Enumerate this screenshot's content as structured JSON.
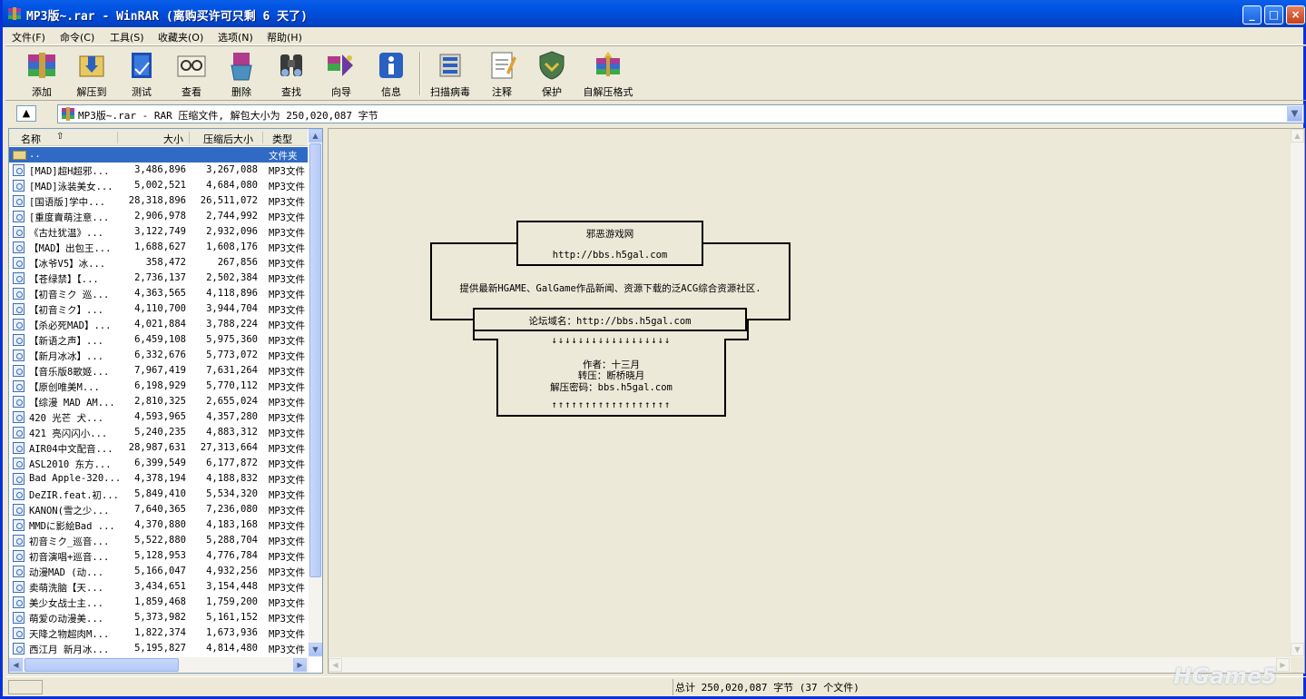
{
  "titlebar": {
    "title": "MP3版~.rar - WinRAR (离购买许可只剩 6 天了)",
    "min": "_",
    "max": "□",
    "close": "×"
  },
  "menu": [
    "文件(F)",
    "命令(C)",
    "工具(S)",
    "收藏夹(O)",
    "选项(N)",
    "帮助(H)"
  ],
  "toolbar": [
    {
      "label": "添加",
      "icon": "add-icon"
    },
    {
      "label": "解压到",
      "icon": "extract-icon"
    },
    {
      "label": "测试",
      "icon": "test-icon"
    },
    {
      "label": "查看",
      "icon": "view-icon"
    },
    {
      "label": "删除",
      "icon": "delete-icon"
    },
    {
      "label": "查找",
      "icon": "find-icon"
    },
    {
      "label": "向导",
      "icon": "wizard-icon"
    },
    {
      "label": "信息",
      "icon": "info-icon"
    },
    {
      "label": "扫描病毒",
      "icon": "virus-scan-icon"
    },
    {
      "label": "注释",
      "icon": "comment-icon"
    },
    {
      "label": "保护",
      "icon": "protect-icon"
    },
    {
      "label": "自解压格式",
      "icon": "sfx-icon"
    }
  ],
  "address": {
    "text": "MP3版~.rar - RAR 压缩文件, 解包大小为 250,020,087 字节"
  },
  "columns": {
    "name": "名称",
    "size": "大小",
    "packed": "压缩后大小",
    "type": "类型"
  },
  "files": [
    {
      "name": "..",
      "size": "",
      "packed": "",
      "type": "文件夹",
      "folder": true
    },
    {
      "name": "[MAD]超H超邪...",
      "size": "3,486,896",
      "packed": "3,267,088",
      "type": "MP3文件"
    },
    {
      "name": "[MAD]泳装美女...",
      "size": "5,002,521",
      "packed": "4,684,080",
      "type": "MP3文件"
    },
    {
      "name": "[国语版]学中...",
      "size": "28,318,896",
      "packed": "26,511,072",
      "type": "MP3文件"
    },
    {
      "name": "[重度賣萌注意...",
      "size": "2,906,978",
      "packed": "2,744,992",
      "type": "MP3文件"
    },
    {
      "name": "《古灶犹温》...",
      "size": "3,122,749",
      "packed": "2,932,096",
      "type": "MP3文件"
    },
    {
      "name": "【MAD】出包王...",
      "size": "1,688,627",
      "packed": "1,608,176",
      "type": "MP3文件"
    },
    {
      "name": "【冰爷V5】冰...",
      "size": "358,472",
      "packed": "267,856",
      "type": "MP3文件"
    },
    {
      "name": "【苍绿禁】【...",
      "size": "2,736,137",
      "packed": "2,502,384",
      "type": "MP3文件"
    },
    {
      "name": "【初音ミク 巡...",
      "size": "4,363,565",
      "packed": "4,118,896",
      "type": "MP3文件"
    },
    {
      "name": "【初音ミク】...",
      "size": "4,110,700",
      "packed": "3,944,704",
      "type": "MP3文件"
    },
    {
      "name": "【杀必死MAD】...",
      "size": "4,021,884",
      "packed": "3,788,224",
      "type": "MP3文件"
    },
    {
      "name": "【新语之声】...",
      "size": "6,459,108",
      "packed": "5,975,360",
      "type": "MP3文件"
    },
    {
      "name": "【新月冰冰】...",
      "size": "6,332,676",
      "packed": "5,773,072",
      "type": "MP3文件"
    },
    {
      "name": "【音乐版8歌姬...",
      "size": "7,967,419",
      "packed": "7,631,264",
      "type": "MP3文件"
    },
    {
      "name": "【原创唯美M...",
      "size": "6,198,929",
      "packed": "5,770,112",
      "type": "MP3文件"
    },
    {
      "name": "【综漫 MAD AM...",
      "size": "2,810,325",
      "packed": "2,655,024",
      "type": "MP3文件"
    },
    {
      "name": "420  光芒 犬...",
      "size": "4,593,965",
      "packed": "4,357,280",
      "type": "MP3文件"
    },
    {
      "name": "421  亮闪闪小...",
      "size": "5,240,235",
      "packed": "4,883,312",
      "type": "MP3文件"
    },
    {
      "name": "AIR04中文配音...",
      "size": "28,987,631",
      "packed": "27,313,664",
      "type": "MP3文件"
    },
    {
      "name": "ASL2010 东方...",
      "size": "6,399,549",
      "packed": "6,177,872",
      "type": "MP3文件"
    },
    {
      "name": "Bad Apple-320...",
      "size": "4,378,194",
      "packed": "4,188,832",
      "type": "MP3文件"
    },
    {
      "name": "DeZIR.feat.初...",
      "size": "5,849,410",
      "packed": "5,534,320",
      "type": "MP3文件"
    },
    {
      "name": "KANON(雪之少...",
      "size": "7,640,365",
      "packed": "7,236,080",
      "type": "MP3文件"
    },
    {
      "name": "MMDに影絵Bad ...",
      "size": "4,370,880",
      "packed": "4,183,168",
      "type": "MP3文件"
    },
    {
      "name": "初音ミク_巡音...",
      "size": "5,522,880",
      "packed": "5,288,704",
      "type": "MP3文件"
    },
    {
      "name": "初音演唱+巡音...",
      "size": "5,128,953",
      "packed": "4,776,784",
      "type": "MP3文件"
    },
    {
      "name": "动漫MAD (动...",
      "size": "5,166,047",
      "packed": "4,932,256",
      "type": "MP3文件"
    },
    {
      "name": "卖萌洗脑【天...",
      "size": "3,434,651",
      "packed": "3,154,448",
      "type": "MP3文件"
    },
    {
      "name": "美少女战士主...",
      "size": "1,859,468",
      "packed": "1,759,200",
      "type": "MP3文件"
    },
    {
      "name": "萌爱の动漫美...",
      "size": "5,373,982",
      "packed": "5,161,152",
      "type": "MP3文件"
    },
    {
      "name": "天降之物超肉M...",
      "size": "1,822,374",
      "packed": "1,673,936",
      "type": "MP3文件"
    },
    {
      "name": "西江月 新月冰...",
      "size": "5,195,827",
      "packed": "4,814,480",
      "type": "MP3文件"
    }
  ],
  "comment": {
    "site_name": "邪恶游戏网",
    "site_url": "http://bbs.h5gal.com",
    "description": "提供最新HGAME、GalGame作品新闻、资源下载的泛ACG综合资源社区.",
    "domain_line": "论坛域名：http://bbs.h5gal.com",
    "author": "作者：十三月",
    "repost": "转压：断桥晓月",
    "password": "解压密码：bbs.h5gal.com",
    "down_arrows": "↓↓↓↓↓↓↓↓↓↓↓↓↓↓↓↓↓↓",
    "up_arrows": "↑↑↑↑↑↑↑↑↑↑↑↑↑↑↑↑↑↑"
  },
  "status": {
    "total": "总计 250,020,087 字节 (37 个文件)"
  },
  "watermark": "HGame5",
  "colors": {
    "selection": "#316ac5",
    "titlebar": "#0054e3"
  }
}
